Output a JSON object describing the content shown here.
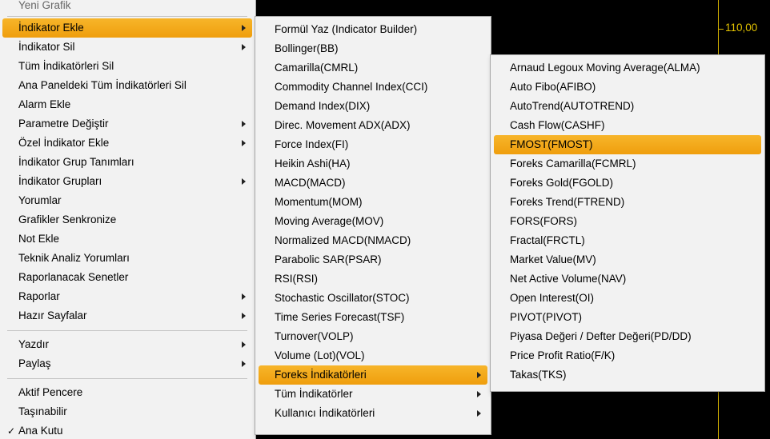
{
  "chart": {
    "price_label": "110,00",
    "accent_color": "#e0c000"
  },
  "menu1": {
    "items": [
      {
        "label": "Yeni Grafik",
        "submenu": false
      },
      {
        "label": "İndikator Ekle",
        "submenu": true,
        "active": true
      },
      {
        "label": "İndikator Sil",
        "submenu": true
      },
      {
        "label": "Tüm İndikatörleri Sil",
        "submenu": false
      },
      {
        "label": "Ana Paneldeki Tüm İndikatörleri Sil",
        "submenu": false
      },
      {
        "label": "Alarm Ekle",
        "submenu": false
      },
      {
        "label": "Parametre Değiştir",
        "submenu": true
      },
      {
        "label": "Özel İndikator Ekle",
        "submenu": true
      },
      {
        "label": "İndikator Grup Tanımları",
        "submenu": false
      },
      {
        "label": "İndikator Grupları",
        "submenu": true
      },
      {
        "label": "Yorumlar",
        "submenu": false
      },
      {
        "label": "Grafikler Senkronize",
        "submenu": false
      },
      {
        "label": "Not Ekle",
        "submenu": false
      },
      {
        "label": "Teknik Analiz Yorumları",
        "submenu": false
      },
      {
        "label": "Raporlanacak Senetler",
        "submenu": false
      },
      {
        "label": "Raporlar",
        "submenu": true
      },
      {
        "label": "Hazır Sayfalar",
        "submenu": true
      },
      {
        "label": "Yazdır",
        "submenu": true
      },
      {
        "label": "Paylaş",
        "submenu": true
      },
      {
        "label": "Aktif Pencere",
        "submenu": false
      },
      {
        "label": "Taşınabilir",
        "submenu": false
      },
      {
        "label": "Ana Kutu",
        "submenu": false,
        "checked": true,
        "check_mark": "✓"
      }
    ]
  },
  "menu2": {
    "items": [
      {
        "label": "Formül Yaz (Indicator Builder)"
      },
      {
        "label": "Bollinger(BB)"
      },
      {
        "label": "Camarilla(CMRL)"
      },
      {
        "label": "Commodity Channel Index(CCI)"
      },
      {
        "label": "Demand Index(DIX)"
      },
      {
        "label": "Direc. Movement ADX(ADX)"
      },
      {
        "label": "Force Index(FI)"
      },
      {
        "label": "Heikin Ashi(HA)"
      },
      {
        "label": "MACD(MACD)"
      },
      {
        "label": "Momentum(MOM)"
      },
      {
        "label": "Moving Average(MOV)"
      },
      {
        "label": "Normalized MACD(NMACD)"
      },
      {
        "label": "Parabolic SAR(PSAR)"
      },
      {
        "label": "RSI(RSI)"
      },
      {
        "label": "Stochastic Oscillator(STOC)"
      },
      {
        "label": "Time Series Forecast(TSF)"
      },
      {
        "label": "Turnover(VOLP)"
      },
      {
        "label": "Volume (Lot)(VOL)"
      },
      {
        "label": "Foreks İndikatörleri",
        "submenu": true,
        "active": true
      },
      {
        "label": "Tüm İndikatörler",
        "submenu": true
      },
      {
        "label": "Kullanıcı İndikatörleri",
        "submenu": true
      }
    ]
  },
  "menu3": {
    "items": [
      {
        "label": "Arnaud Legoux Moving Average(ALMA)"
      },
      {
        "label": "Auto Fibo(AFIBO)"
      },
      {
        "label": "AutoTrend(AUTOTREND)"
      },
      {
        "label": "Cash Flow(CASHF)"
      },
      {
        "label": "FMOST(FMOST)",
        "active": true
      },
      {
        "label": "Foreks Camarilla(FCMRL)"
      },
      {
        "label": "Foreks Gold(FGOLD)"
      },
      {
        "label": "Foreks Trend(FTREND)"
      },
      {
        "label": "FORS(FORS)"
      },
      {
        "label": "Fractal(FRCTL)"
      },
      {
        "label": "Market Value(MV)"
      },
      {
        "label": "Net Active Volume(NAV)"
      },
      {
        "label": "Open Interest(OI)"
      },
      {
        "label": "PIVOT(PIVOT)"
      },
      {
        "label": "Piyasa Değeri / Defter Değeri(PD/DD)"
      },
      {
        "label": "Price Profit Ratio(F/K)"
      },
      {
        "label": "Takas(TKS)"
      }
    ]
  }
}
